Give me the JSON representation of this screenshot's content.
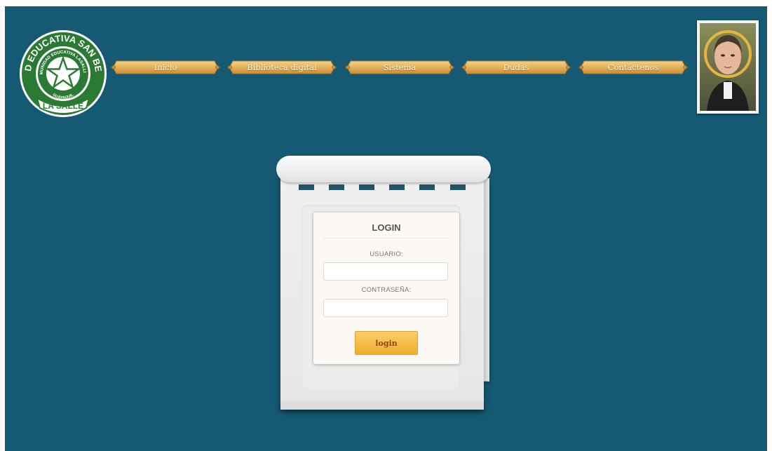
{
  "logo": {
    "arc_text": "UNIDAD EDUCATIVA SAN BENILDO",
    "inner_text": "COMUNIDAD EDUCATIVA LASALLISTA",
    "city_text": "GUAYAQUIL",
    "banner_text": "LA SALLE"
  },
  "nav": {
    "items": [
      "Inicio",
      "Biblioteca digital",
      "Sistema",
      "Dudas",
      "Contáctenos"
    ]
  },
  "login": {
    "title": "LOGIN",
    "username_label": "USUARIO:",
    "username_value": "",
    "password_label": "CONTRASEÑA:",
    "password_value": "",
    "button_label": "login"
  },
  "colors": {
    "page_background": "#155a72",
    "nav_gold": "#e3b25c",
    "logo_green": "#2b7a33",
    "button_orange": "#f0ad2a"
  },
  "icons": [
    "school-seal-logo",
    "star-icon",
    "saint-portrait"
  ]
}
